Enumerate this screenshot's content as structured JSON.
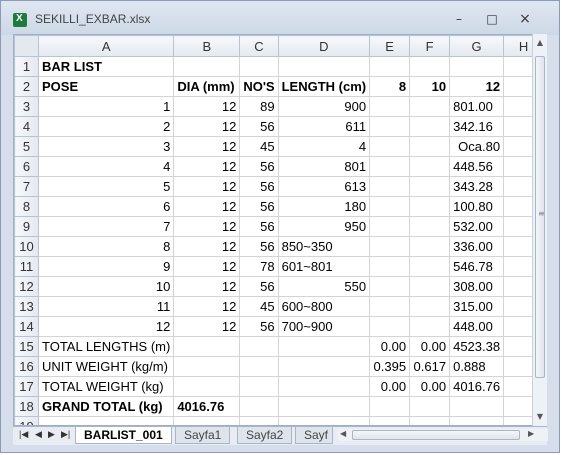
{
  "window": {
    "title": "SEKILLI_EXBAR.xlsx"
  },
  "columns": [
    "A",
    "B",
    "C",
    "D",
    "E",
    "F",
    "G",
    "H"
  ],
  "rows": [
    {
      "n": "1",
      "a": "BAR LIST",
      "b": "",
      "c": "",
      "d": "",
      "e": "",
      "f": "",
      "g": ""
    },
    {
      "n": "2",
      "a": "POSE",
      "b": "DIA (mm)",
      "c": "NO'S",
      "d": "LENGTH (cm)",
      "e": "8",
      "f": "10",
      "g": "12"
    },
    {
      "n": "3",
      "a": "1",
      "b": "12",
      "c": "89",
      "d": "900",
      "e": "",
      "f": "",
      "g": "801.00"
    },
    {
      "n": "4",
      "a": "2",
      "b": "12",
      "c": "56",
      "d": "611",
      "e": "",
      "f": "",
      "g": "342.16"
    },
    {
      "n": "5",
      "a": "3",
      "b": "12",
      "c": "45",
      "d": "4",
      "e": "",
      "f": "",
      "g": "Oca.80"
    },
    {
      "n": "6",
      "a": "4",
      "b": "12",
      "c": "56",
      "d": "801",
      "e": "",
      "f": "",
      "g": "448.56"
    },
    {
      "n": "7",
      "a": "5",
      "b": "12",
      "c": "56",
      "d": "613",
      "e": "",
      "f": "",
      "g": "343.28"
    },
    {
      "n": "8",
      "a": "6",
      "b": "12",
      "c": "56",
      "d": "180",
      "e": "",
      "f": "",
      "g": "100.80"
    },
    {
      "n": "9",
      "a": "7",
      "b": "12",
      "c": "56",
      "d": "950",
      "e": "",
      "f": "",
      "g": "532.00"
    },
    {
      "n": "10",
      "a": "8",
      "b": "12",
      "c": "56",
      "d": "850~350",
      "e": "",
      "f": "",
      "g": "336.00"
    },
    {
      "n": "11",
      "a": "9",
      "b": "12",
      "c": "78",
      "d": "601~801",
      "e": "",
      "f": "",
      "g": "546.78"
    },
    {
      "n": "12",
      "a": "10",
      "b": "12",
      "c": "56",
      "d": "550",
      "e": "",
      "f": "",
      "g": "308.00"
    },
    {
      "n": "13",
      "a": "11",
      "b": "12",
      "c": "45",
      "d": "600~800",
      "e": "",
      "f": "",
      "g": "315.00"
    },
    {
      "n": "14",
      "a": "12",
      "b": "12",
      "c": "56",
      "d": "700~900",
      "e": "",
      "f": "",
      "g": "448.00"
    },
    {
      "n": "15",
      "a": "TOTAL LENGTHS (m)",
      "b": "",
      "c": "",
      "d": "",
      "e": "0.00",
      "f": "0.00",
      "g": "4523.38"
    },
    {
      "n": "16",
      "a": "UNIT WEIGHT (kg/m)",
      "b": "",
      "c": "",
      "d": "",
      "e": "0.395",
      "f": "0.617",
      "g": "0.888"
    },
    {
      "n": "17",
      "a": "TOTAL WEIGHT (kg)",
      "b": "",
      "c": "",
      "d": "",
      "e": "0.00",
      "f": "0.00",
      "g": "4016.76"
    },
    {
      "n": "18",
      "a": "GRAND TOTAL (kg)",
      "b": "4016.76",
      "c": "",
      "d": "",
      "e": "",
      "f": "",
      "g": ""
    },
    {
      "n": "19",
      "a": "",
      "b": "",
      "c": "",
      "d": "",
      "e": "",
      "f": "",
      "g": ""
    }
  ],
  "tabs": {
    "t1": "BARLIST_001",
    "t2": "Sayfa1",
    "t3": "Sayfa2",
    "t4": "Sayf"
  },
  "icons": {
    "app": "excel-icon",
    "minimize": "minimize-icon",
    "restore": "restore-icon",
    "close": "close-icon"
  }
}
